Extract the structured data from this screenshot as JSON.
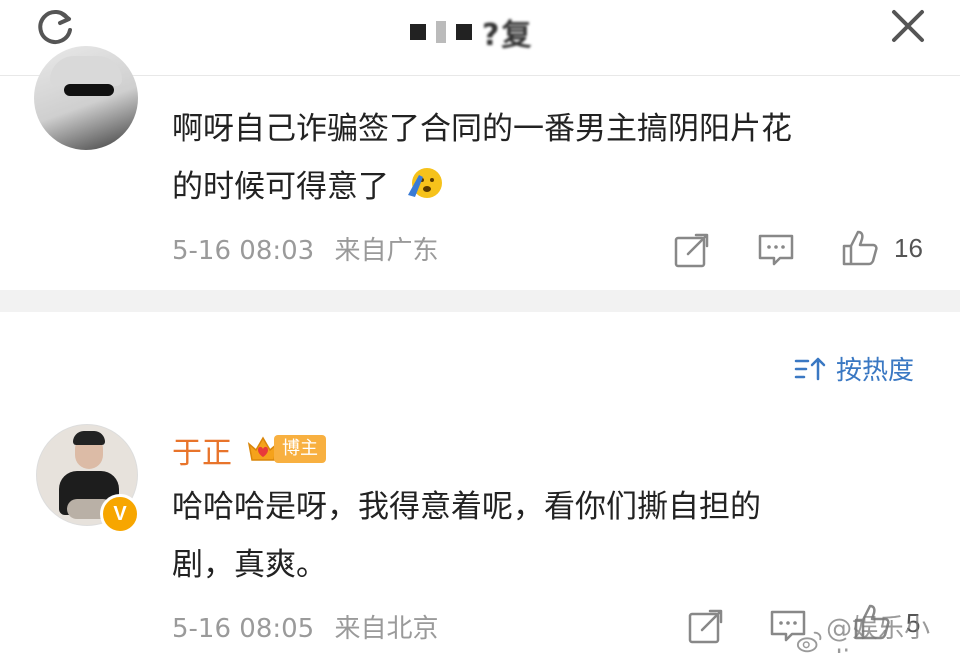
{
  "header": {
    "title_partial": "?复",
    "refresh_icon": "refresh-icon",
    "close_icon": "close-icon"
  },
  "comments": [
    {
      "text_line1": "啊呀自己诈骗签了合同的一番男主搞阴阳片花",
      "text_line2": "的时候可得意了",
      "emoji": "salute-face-emoji",
      "time": "5-16 08:03",
      "source": "来自广东",
      "likes": "16"
    },
    {
      "author": "于正",
      "badge": "博主",
      "verified": "V",
      "text_line1": "哈哈哈是呀，我得意着呢，看你们撕自担的",
      "text_line2": "剧，真爽。",
      "time": "5-16 08:05",
      "source": "来自北京",
      "likes": "5"
    }
  ],
  "sort": {
    "label": "按热度",
    "icon": "sort-icon"
  },
  "watermark": {
    "text": "@娱乐小dio"
  },
  "colors": {
    "accent_blue": "#3a78c3",
    "author_orange": "#e8742b",
    "badge_gold": "#f8b040",
    "meta_gray": "#9a9a9a"
  }
}
